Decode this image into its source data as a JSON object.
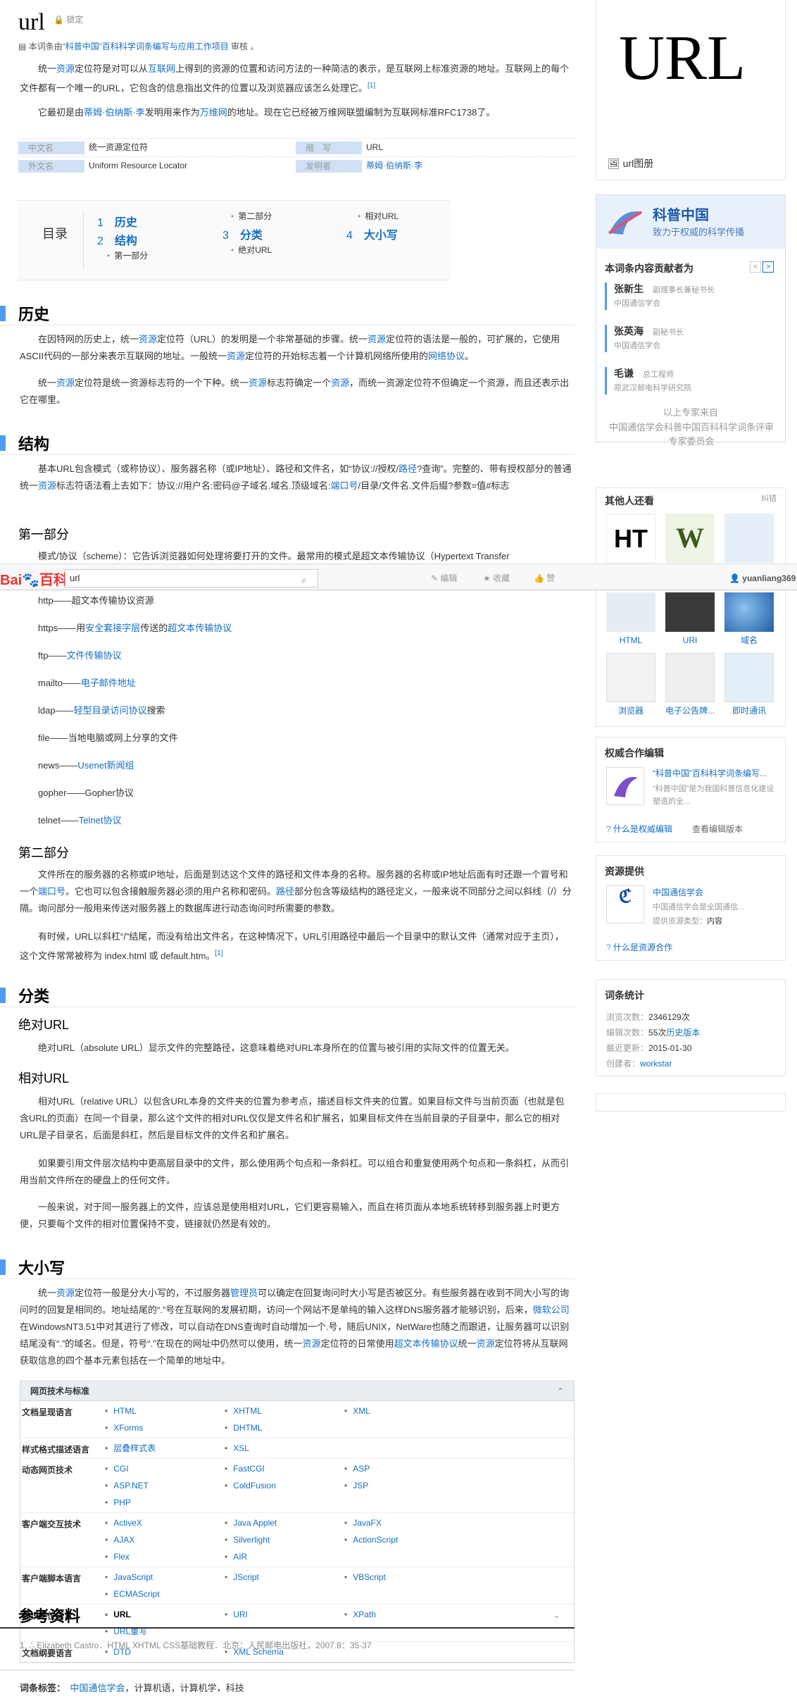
{
  "title": "url",
  "lock_label": "锁定",
  "audit": {
    "pre": "本词条由",
    "link": "“科普中国”百科科学词条编写与应用工作项目",
    "post": " 审核 。"
  },
  "intro": {
    "p1": [
      "统一",
      "资源",
      "定位符是对可以从",
      "互联网",
      "上得到的资源的位置和访问方法的一种简洁的表示，是互联网上标准资源的地址。互联网上的每个文件都有一个唯一的URL，它包含的信息指出文件的位置以及浏览器应该怎么处理它。",
      "[1]"
    ],
    "p2": [
      "它最初是由",
      "蒂姆·伯纳斯·李",
      "发明用来作为",
      "万维网",
      "的地址。现在它已经被万维网联盟编制为互联网标准RFC1738了。"
    ]
  },
  "basic_info": [
    {
      "k1": "中文名",
      "v1": "统一资源定位符",
      "k2": "缩　写",
      "v2": "URL"
    },
    {
      "k1": "外文名",
      "v1": "Uniform Resource Locator",
      "k2": "发明者",
      "v2": "蒂姆·伯纳斯·李"
    }
  ],
  "toc": {
    "label": "目录",
    "items": [
      {
        "n": "1",
        "t": "历史"
      },
      {
        "n": "2",
        "t": "结构"
      },
      {
        "n": "3",
        "t": "分类"
      },
      {
        "n": "4",
        "t": "大小写"
      }
    ],
    "subs": [
      "第一部分",
      "第二部分",
      "绝对URL",
      "相对URL"
    ]
  },
  "sections": {
    "history": {
      "title": "历史",
      "p1": [
        "在因特网的历史上，统一",
        "资源",
        "定位符（URL）的发明是一个非常基础的步骤。统一",
        "资源",
        "定位符的语法是一般的，可扩展的，它使用ASCII代码的一部分来表示互联网的地址。一般统一",
        "资源",
        "定位符的开始标志着一个计算机网络所使用的",
        "网络协议",
        "。"
      ],
      "p2": [
        "统一",
        "资源",
        "定位符是统一资源标志符的一个下种。统一",
        "资源",
        "标志符确定一个",
        "资源",
        "，而统一资源定位符不但确定一个资源，而且还表示出它在哪里。"
      ]
    },
    "structure": {
      "title": "结构",
      "p1": [
        "基本URL包含模式（或称协议）、服务器名称（或IP地址）、路径和文件名，如“协议://授权/",
        "路径",
        "?查询”。完整的、带有授权部分的普通统一",
        "资源",
        "标志符语法看上去如下：协议://用户名:密码@子域名.域名.顶级域名:",
        "端口号",
        "/目录/文件名.文件后缀?参数=值#标志"
      ],
      "part1": "第一部分",
      "part1_text": "模式/协议（scheme）：它告诉浏览器如何处理将要打开的文件。最常用的模式是超文本传输协议（Hypertext Transfer",
      "protocols": [
        {
          "a": "http——超文本传输协议资源",
          "b": "",
          "c": ""
        },
        {
          "a": "https——用",
          "b": "安全套接字层",
          "c": "传送的",
          "d": "超文本传输协议"
        },
        {
          "a": "ftp——",
          "b": "文件传输协议",
          "c": ""
        },
        {
          "a": "mailto——",
          "b": "电子邮件地址",
          "c": ""
        },
        {
          "a": "ldap——",
          "b": "轻型目录访问协议",
          "c": "搜索"
        },
        {
          "a": "file——当地电脑或网上分享的文件",
          "b": "",
          "c": ""
        },
        {
          "a": "news——",
          "b": "Usenet新闻组",
          "c": ""
        },
        {
          "a": "gopher——Gopher协议",
          "b": "",
          "c": ""
        },
        {
          "a": "telnet——",
          "b": "Telnet协议",
          "c": ""
        }
      ],
      "part2": "第二部分",
      "part2_p1": [
        "文件所在的服务器的名称或IP地址，后面是到达这个文件的路径和文件本身的名称。服务器的名称或IP地址后面有时还跟一个冒号和一个",
        "端口号",
        "。它也可以包含接触服务器必须的用户名称和密码。",
        "路径",
        "部分包含等级结构的路径定义，一般来说不同部分之间以斜线（/）分隔。询问部分一般用来传送对服务器上的数据库进行动态询问时所需要的参数。"
      ],
      "part2_p2": [
        "有时候，URL以斜杠“/”结尾，而没有给出文件名，在这种情况下，URL引用路径中最后一个目录中的默认文件（通常对应于主页），这个文件常常被称为 index.html 或 default.htm。",
        "[1]"
      ]
    },
    "category": {
      "title": "分类",
      "abs": "绝对URL",
      "abs_p": "绝对URL（absolute URL）显示文件的完整路径，这意味着绝对URL本身所在的位置与被引用的实际文件的位置无关。",
      "rel": "相对URL",
      "rel_p1": "相对URL（relative URL）以包含URL本身的文件夹的位置为参考点，描述目标文件夹的位置。如果目标文件与当前页面（也就是包含URL的页面）在同一个目录，那么这个文件的相对URL仅仅是文件名和扩展名，如果目标文件在当前目录的子目录中，那么它的相对URL是子目录名，后面是斜杠，然后是目标文件的文件名和扩展名。",
      "rel_p2": "如果要引用文件层次结构中更高层目录中的文件，那么使用两个句点和一条斜杠。可以组合和重复使用两个句点和一条斜杠，从而引用当前文件所在的硬盘上的任何文件。",
      "rel_p3": "一般来说，对于同一服务器上的文件，应该总是使用相对URL，它们更容易输入，而且在将页面从本地系统转移到服务器上时更方便，只要每个文件的相对位置保持不变，链接就仍然是有效的。"
    },
    "case": {
      "title": "大小写",
      "p": [
        "统一",
        "资源",
        "定位符一般是分大小写的，不过服务器",
        "管理员",
        "可以确定在回复询问时大小写是否被区分。有些服务器在收到不同大小写的询问时的回复是相同的。地址结尾的“.”号在互联网的发展初期，访问一个网站不是单纯的输入这样DNS服务器才能够识别，后来，",
        "微软公司",
        "在WindowsNT3.51中对其进行了修改，可以自动在DNS查询时自动增加一个.号，随后UNIX，NetWare也随之而跟进，让服务器可以识别结尾没有“.”的域名。但是，符号“.”在现在的网址中仍然可以使用，统一",
        "资源",
        "定位符的日常使用",
        "超文本传输协议",
        "统一",
        "资源",
        "定位符将从互联网获取信息的四个基本元素包括在一个简单的地址中。"
      ]
    }
  },
  "navbox": {
    "title": "网页技术与标准",
    "toggle": "⌃",
    "rows": [
      {
        "k": "文档呈现语言",
        "v": [
          "HTML",
          "XHTML",
          "XML",
          "XForms",
          "DHTML"
        ]
      },
      {
        "k": "样式格式描述语言",
        "v": [
          "层叠样式表",
          "XSL"
        ]
      },
      {
        "k": "动态网页技术",
        "v": [
          "CGI",
          "FastCGI",
          "ASP",
          "ASP.NET",
          "ColdFusion",
          "JSP",
          "PHP"
        ]
      },
      {
        "k": "客户端交互技术",
        "v": [
          "ActiveX",
          "Java Applet",
          "JavaFX",
          "AJAX",
          "Silverlight",
          "ActionScript",
          "Flex",
          "AIR"
        ]
      },
      {
        "k": "客户端脚本语言",
        "v": [
          "JavaScript",
          "JScript",
          "VBScript",
          "ECMAScript"
        ]
      },
      {
        "k": "标识定位语言",
        "v": [
          "URL",
          "URI",
          "XPath",
          "URL重写"
        ]
      },
      {
        "k": "文档纲要语言",
        "v": [
          "DTD",
          "XML Schema"
        ]
      }
    ]
  },
  "refs": {
    "title": "参考资料",
    "item": "1. ∴ Elizabeth Castro．HTML XHTML CSS基础教程．北京：人民邮电出版社，2007.8：35-37"
  },
  "tags": {
    "label": "词条标签：",
    "items": [
      "中国通信学会",
      "计算机语",
      "计算机学",
      "科技"
    ]
  },
  "topbar": {
    "logo_a": "Bai",
    "logo_paw": "🐾",
    "logo_b": "百科",
    "search_value": "url",
    "edit": "✎ 编辑",
    "fav": "★ 收藏",
    "like": "👍 赞",
    "user": "yuanliang369"
  },
  "side": {
    "image_text": "URL",
    "album": "url图册",
    "kepu": {
      "brand": "科普中国",
      "slogan": "致力于权威的科学传播"
    },
    "contrib_title": "本词条内容贡献者为",
    "experts": [
      {
        "name": "张新生",
        "role": "副理事长兼秘书长",
        "org": "中国通信学会"
      },
      {
        "name": "张英海",
        "role": "副秘书长",
        "org": "中国通信学会"
      },
      {
        "name": "毛谦",
        "role": "总工程师",
        "org": "原武汉邮电科学研究院"
      }
    ],
    "review_lbl": "以上专家来自",
    "review_org": "中国通信学会科普中国百科科学词条评审专家委员会",
    "also_title": "其他人还看",
    "also_err": "纠错",
    "also_labels": [
      "HTML",
      "URI",
      "域名",
      "浏览器",
      "电子公告牌...",
      "即时通讯"
    ],
    "auth_title": "权威合作编辑",
    "auth_link": "“科普中国”百科科学词条编写...",
    "auth_desc": "“科普中国”是为我国科普信息化建设塑造的全...",
    "auth_q": "什么是权威编辑",
    "auth_ver": "查看编辑版本",
    "res_title": "资源提供",
    "res_name": "中国通信学会",
    "res_desc": "中国通信学会是全国通信...",
    "res_type": "提供资源类型：",
    "res_type_v": "内容",
    "res_q": "什么是资源合作",
    "stat_title": "词条统计",
    "views_l": "浏览次数：",
    "views": "2346129次",
    "edits_l": "编辑次数：",
    "edits": "55次",
    "hist": "历史版本",
    "upd_l": "最近更新：",
    "upd": "2015-01-30",
    "creator_l": "创建者：",
    "creator": "workstar"
  }
}
